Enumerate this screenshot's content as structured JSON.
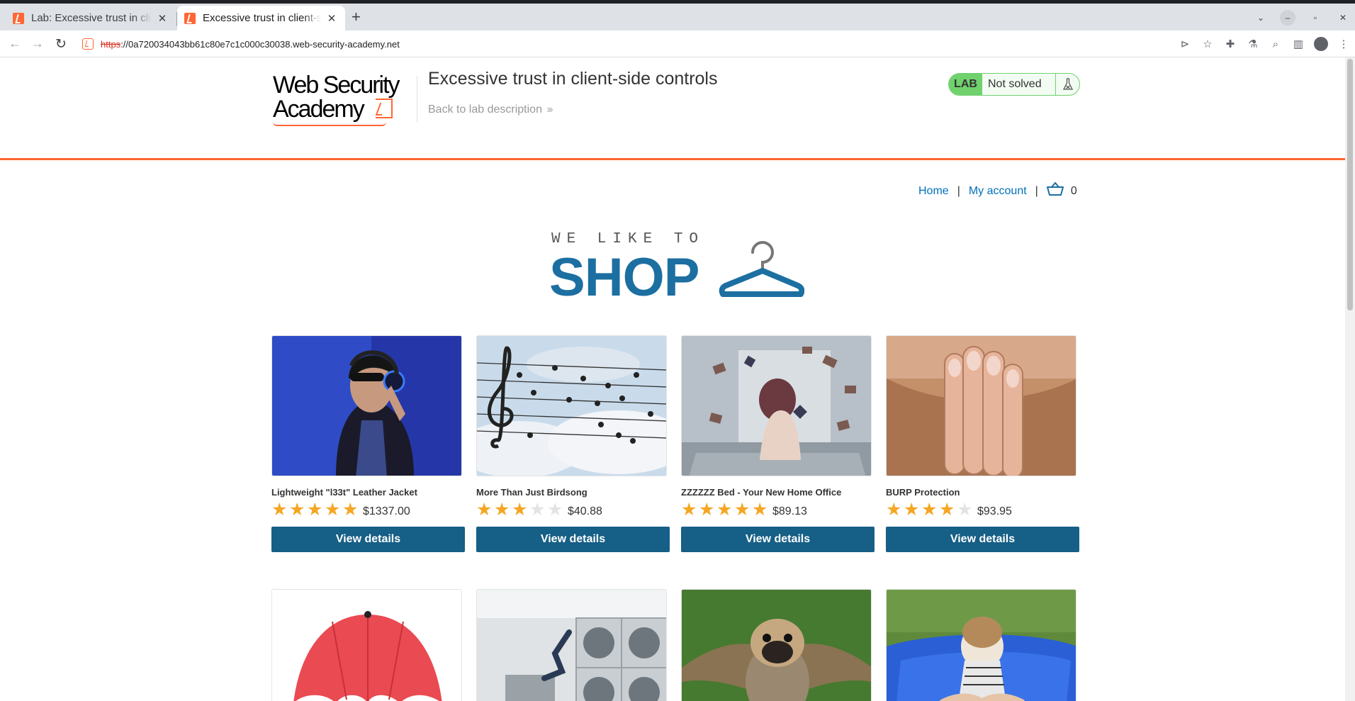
{
  "browser": {
    "tabs": [
      {
        "title": "Lab: Excessive trust in client-side controls",
        "active": false
      },
      {
        "title": "Excessive trust in client-side controls",
        "active": true
      }
    ],
    "url_scheme": "https",
    "url_rest": "://0a720034043bb61c80e7c1c000c30038.web-security-academy.net"
  },
  "header": {
    "logo_line1": "Web Security",
    "logo_line2": "Academy",
    "lab_title": "Excessive trust in client-side controls",
    "back_link": "Back to lab description",
    "lab_badge": "LAB",
    "lab_status": "Not solved"
  },
  "nav": {
    "home": "Home",
    "sep1": "|",
    "account": "My account",
    "sep2": "|",
    "cart_count": "0"
  },
  "banner": {
    "tagline": "WE LIKE TO",
    "word": "SHOP"
  },
  "products": [
    {
      "name": "Lightweight \"l33t\" Leather Jacket",
      "rating": 5,
      "price": "$1337.00",
      "button": "View details",
      "image": "jacket-headphones"
    },
    {
      "name": "More Than Just Birdsong",
      "rating": 3,
      "price": "$40.88",
      "button": "View details",
      "image": "birds-music-staff"
    },
    {
      "name": "ZZZZZZ Bed - Your New Home Office",
      "rating": 5,
      "price": "$89.13",
      "button": "View details",
      "image": "bed-flying-books"
    },
    {
      "name": "BURP Protection",
      "rating": 4,
      "price": "$93.95",
      "button": "View details",
      "image": "beard-hand"
    },
    {
      "image": "red-umbrella"
    },
    {
      "image": "laundromat"
    },
    {
      "image": "pug-wings"
    },
    {
      "image": "beanbag-girl"
    }
  ],
  "colors": {
    "accent_orange": "#ff6633",
    "lab_green": "#70d16d",
    "button_blue": "#165f86",
    "link_blue": "#0071bc",
    "star": "#f5a623"
  }
}
